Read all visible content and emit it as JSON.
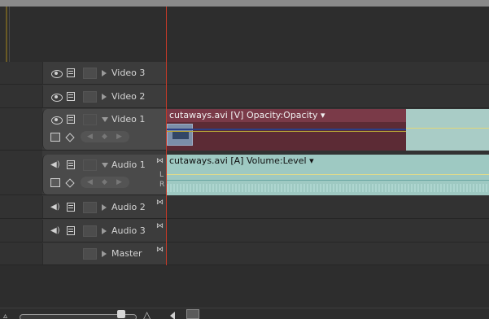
{
  "tracks": {
    "video3": {
      "label": "Video 3"
    },
    "video2": {
      "label": "Video 2"
    },
    "video1": {
      "label": "Video 1"
    },
    "audio1": {
      "label": "Audio 1",
      "channel_left": "L",
      "channel_right": "R"
    },
    "audio2": {
      "label": "Audio 2"
    },
    "audio3": {
      "label": "Audio 3"
    },
    "master": {
      "label": "Master"
    }
  },
  "clips": {
    "video": {
      "title": "cutaways.avi [V] Opacity:Opacity ▾"
    },
    "audio": {
      "title": "cutaways.avi [A] Volume:Level ▾"
    }
  },
  "icons": {
    "eye": "eye-icon",
    "speaker": "speaker-icon",
    "filmstrip": "filmstrip-icon",
    "sync": "sync-lock-icon"
  },
  "colors": {
    "playhead": "#c43a28",
    "video_clip": "#7a3a48",
    "audio_clip": "#9ec9c2"
  }
}
